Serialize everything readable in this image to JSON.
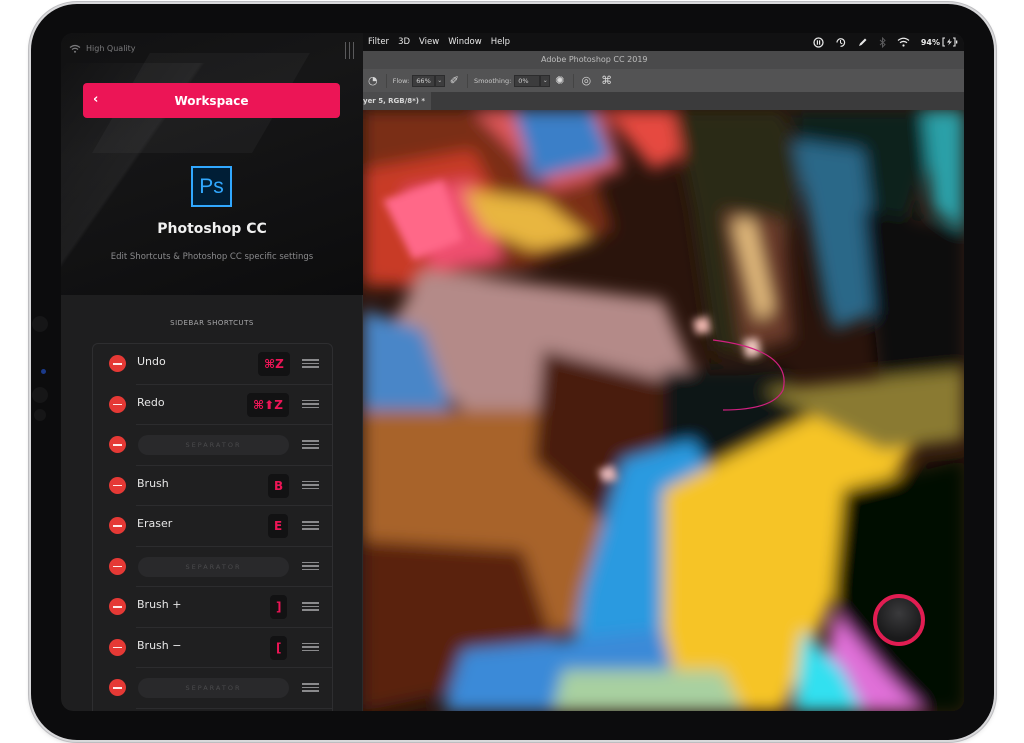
{
  "status": {
    "connection_label": "High Quality",
    "battery": "94%"
  },
  "sidebar": {
    "back_label": "‹",
    "workspace_label": "Workspace",
    "app_logo": "Ps",
    "app_title": "Photoshop CC",
    "app_subtitle": "Edit Shortcuts & Photoshop CC specific settings",
    "section_title": "SIDEBAR SHORTCUTS",
    "shortcuts": [
      {
        "type": "shortcut",
        "label": "Undo",
        "key": "⌘Z"
      },
      {
        "type": "shortcut",
        "label": "Redo",
        "key": "⌘⬆Z"
      },
      {
        "type": "separator",
        "label": "SEPARATOR"
      },
      {
        "type": "shortcut",
        "label": "Brush",
        "key": "B"
      },
      {
        "type": "shortcut",
        "label": "Eraser",
        "key": "E"
      },
      {
        "type": "separator",
        "label": "SEPARATOR"
      },
      {
        "type": "shortcut",
        "label": "Brush +",
        "key": "]"
      },
      {
        "type": "shortcut",
        "label": "Brush −",
        "key": "["
      },
      {
        "type": "separator",
        "label": "SEPARATOR"
      }
    ]
  },
  "photoshop": {
    "menu": [
      "Filter",
      "3D",
      "View",
      "Window",
      "Help"
    ],
    "window_title": "Adobe Photoshop CC 2019",
    "options": {
      "flow_label": "Flow:",
      "flow_value": "66%",
      "smoothing_label": "Smoothing:",
      "smoothing_value": "0%"
    },
    "doc_tab": "yer 5, RGB/8*) *"
  },
  "colors": {
    "accent": "#ec1556",
    "remove": "#e53935",
    "ps_blue": "#31a8ff"
  }
}
